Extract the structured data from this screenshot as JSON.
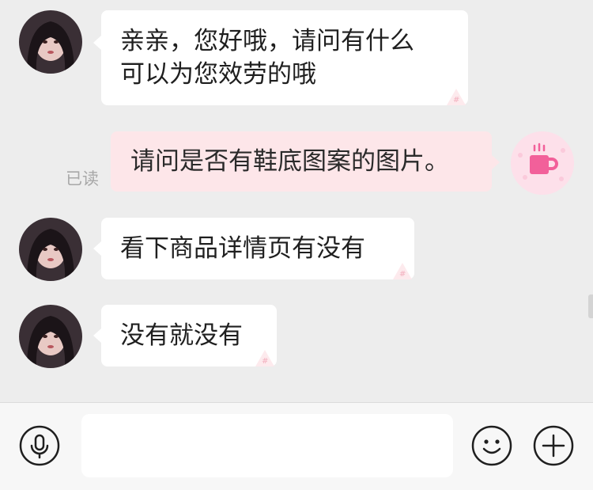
{
  "messages": [
    {
      "side": "in",
      "text": "亲亲，您好哦，请问有什么可以为您效劳的哦",
      "lines": [
        "亲亲，您好哦，请问有什么",
        "可以为您效劳的哦"
      ]
    },
    {
      "side": "out",
      "text": "请问是否有鞋底图案的图片。",
      "status": "已读"
    },
    {
      "side": "in",
      "text": "看下商品详情页有没有"
    },
    {
      "side": "in",
      "text": "没有就没有"
    }
  ],
  "input_bar": {
    "voice_icon": "microphone-icon",
    "emoji_icon": "smiley-icon",
    "plus_icon": "plus-circle-icon",
    "value": ""
  },
  "colors": {
    "background": "#ededed",
    "incoming_bubble": "#ffffff",
    "outgoing_bubble": "#fde6e9",
    "user_avatar_bg": "#fde0ea",
    "user_avatar_icon": "#f2609a"
  }
}
